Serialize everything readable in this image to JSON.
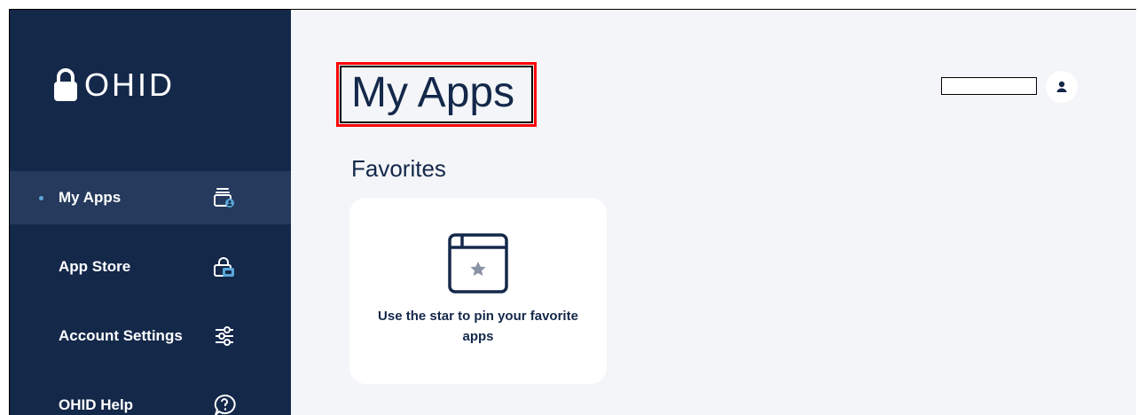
{
  "brand": {
    "name": "OHID"
  },
  "sidebar": {
    "items": [
      {
        "label": "My Apps",
        "icon": "my-apps-icon",
        "active": true
      },
      {
        "label": "App Store",
        "icon": "app-store-icon",
        "active": false
      },
      {
        "label": "Account Settings",
        "icon": "settings-sliders-icon",
        "active": false
      },
      {
        "label": "OHID Help",
        "icon": "help-chat-icon",
        "active": false
      }
    ]
  },
  "main": {
    "title": "My Apps",
    "favorites": {
      "heading": "Favorites",
      "empty_message": "Use the star to pin your favorite apps",
      "empty_icon": "star-window-icon"
    }
  },
  "header": {
    "user_name": "",
    "avatar_icon": "user-icon"
  },
  "colors": {
    "sidebar_bg": "#14284a",
    "sidebar_active_bg": "#253a5c",
    "accent": "#5aa7d9",
    "main_bg": "#f3f5f8",
    "text_dark": "#14284a",
    "highlight_box": "#ff0000"
  }
}
